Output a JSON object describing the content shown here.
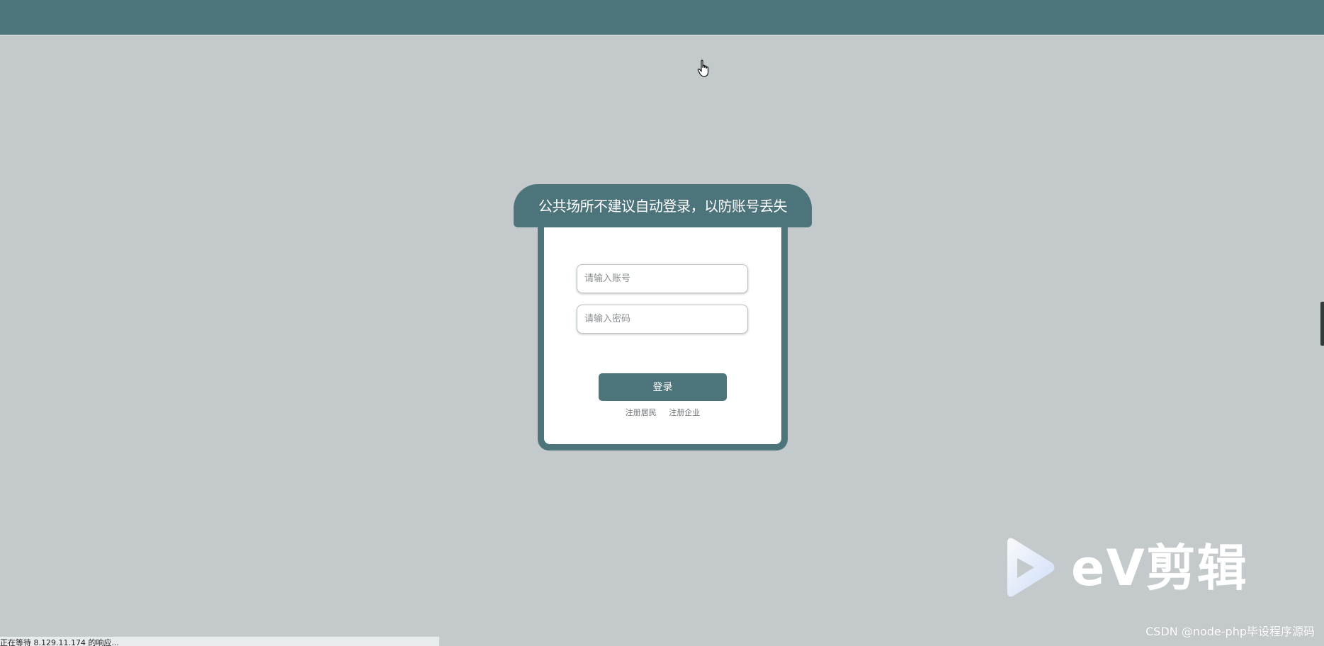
{
  "header": {
    "color": "#4d747b"
  },
  "login": {
    "notice": "公共场所不建议自动登录，以防账号丢失",
    "account_placeholder": "请输入账号",
    "password_placeholder": "请输入密码",
    "login_label": "登录",
    "register_resident": "注册居民",
    "register_company": "注册企业"
  },
  "status_bar": {
    "text": "正在等待 8.129.11.174 的响应..."
  },
  "watermark": {
    "ev_text": "eV剪辑",
    "csdn_text": "CSDN @node-php毕设程序源码"
  },
  "icons": {
    "cursor": "hand-pointer-icon",
    "ev_logo": "play-triangle-icon"
  },
  "colors": {
    "accent": "#4d747b",
    "background": "#c4c9cc",
    "panel": "#ffffff"
  }
}
